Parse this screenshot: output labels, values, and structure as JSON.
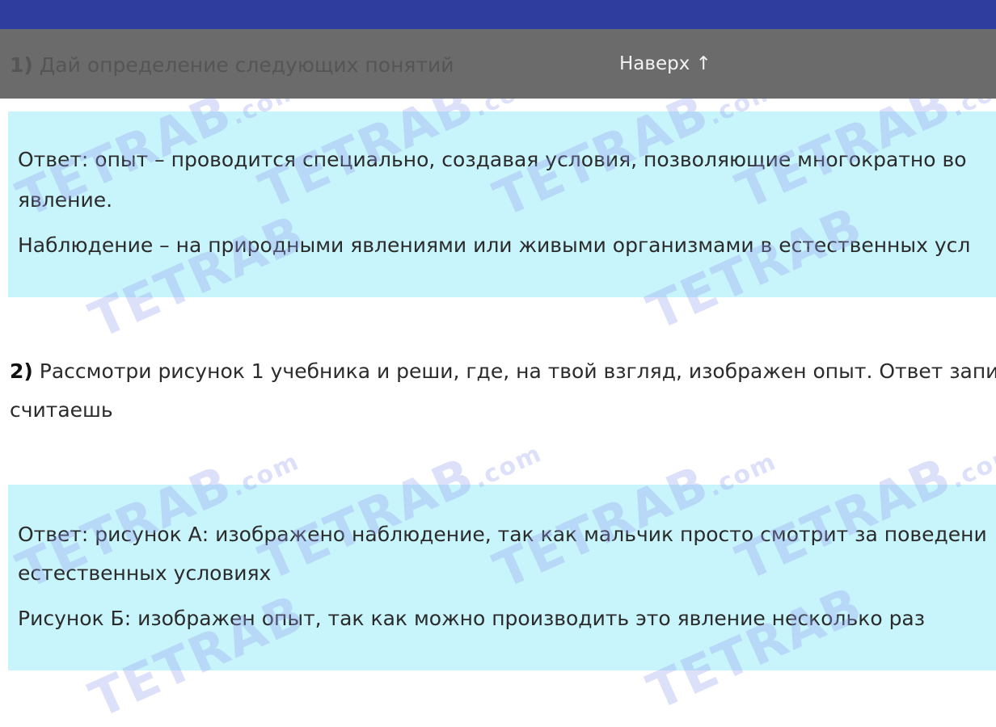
{
  "header": {
    "partial_heading_number": "1)",
    "partial_heading_text": " Дай определение следующих понятий",
    "back_to_top_label": "Наверх ↑"
  },
  "answer1": {
    "lines": [
      "Ответ: опыт – проводится специально, создавая условия, позволяющие многократно во",
      "явление.",
      "Наблюдение – на природными явлениями или живыми организмами в естественных усл"
    ]
  },
  "question2": {
    "number": "2)",
    "text": " Рассмотри рисунок 1 учебника и реши, где, на твой взгляд, изображен опыт. Ответ запи",
    "text_line2": "считаешь"
  },
  "answer2": {
    "lines": [
      "Ответ: рисунок А: изображено наблюдение, так как мальчик просто смотрит за поведени",
      "естественных условиях",
      "Рисунок Б: изображен опыт, так как можно производить это явление несколько раз"
    ]
  },
  "watermark": {
    "text": "TETRAB",
    "suffix": ".com"
  },
  "colors": {
    "top_bar": "#2f3e9e",
    "header_overlay": "#6b6b6b",
    "answer_background": "#c8f4fb",
    "watermark": "#96a0eb"
  }
}
